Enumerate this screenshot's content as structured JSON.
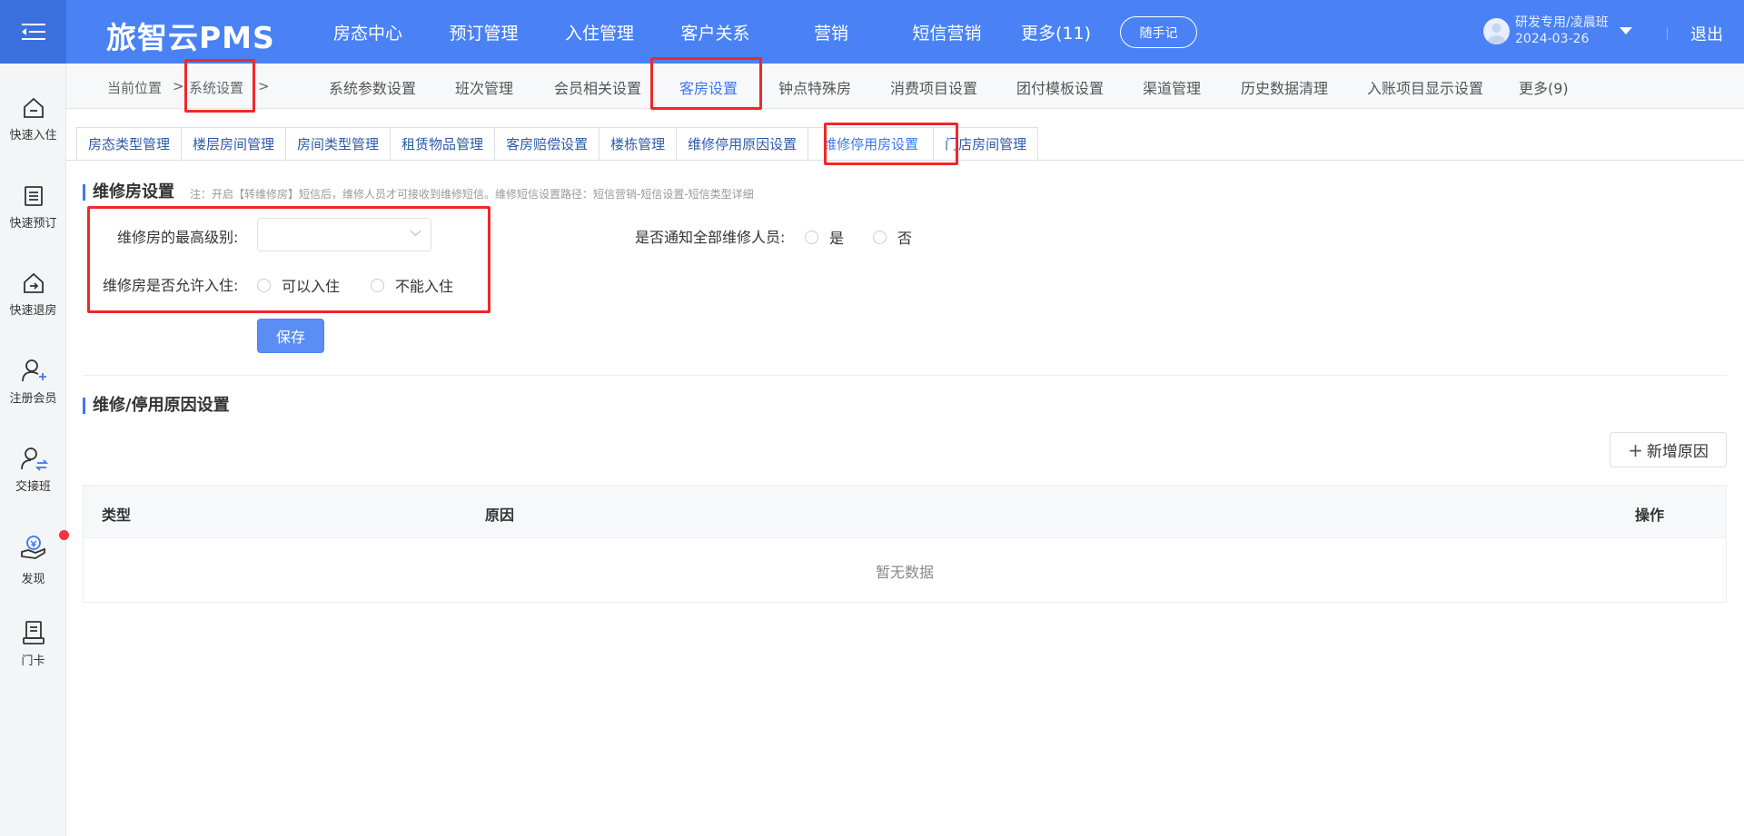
{
  "header": {
    "brand": "旅智云PMS",
    "nav": [
      "房态中心",
      "预订管理",
      "入住管理",
      "客户关系",
      "营销",
      "短信营销",
      "更多(11)"
    ],
    "memo_label": "随手记",
    "user_name": "研发专用/凌晨班",
    "user_date": "2024-03-26",
    "logout_label": "退出"
  },
  "sidebar": {
    "items": [
      {
        "label": "快速入住",
        "icon": "home-in-icon"
      },
      {
        "label": "快速预订",
        "icon": "booking-list-icon"
      },
      {
        "label": "快速退房",
        "icon": "checkout-icon"
      },
      {
        "label": "注册会员",
        "icon": "add-member-icon"
      },
      {
        "label": "交接班",
        "icon": "shift-change-icon"
      },
      {
        "label": "发现",
        "icon": "discover-icon"
      },
      {
        "label": "门卡",
        "icon": "door-card-icon"
      }
    ]
  },
  "breadcrumb": {
    "current_label": "当前位置",
    "sep": ">",
    "item": "系统设置"
  },
  "subnav": {
    "items": [
      "系统参数设置",
      "班次管理",
      "会员相关设置",
      "客房设置",
      "钟点特殊房",
      "消费项目设置",
      "团付模板设置",
      "渠道管理",
      "历史数据清理",
      "入账项目显示设置",
      "更多(9)"
    ],
    "active": "客房设置"
  },
  "tabs": {
    "items": [
      "房态类型管理",
      "楼层房间管理",
      "房间类型管理",
      "租赁物品管理",
      "客房赔偿设置",
      "楼栋管理",
      "维修停用原因设置",
      "维修停用房设置",
      "门店房间管理"
    ],
    "active": "维修停用房设置"
  },
  "repair_settings": {
    "title": "维修房设置",
    "note": "注：开启【转维修房】短信后，维修人员才可接收到维修短信。维修短信设置路径：短信营销-短信设置-短信类型详细",
    "max_level_label": "维修房的最高级别:",
    "max_level_value": "",
    "notify_label": "是否通知全部维修人员:",
    "notify_yes": "是",
    "notify_no": "否",
    "allow_label": "维修房是否允许入住:",
    "allow_yes": "可以入住",
    "allow_no": "不能入住",
    "save_label": "保存"
  },
  "reason_settings": {
    "title": "维修/停用原因设置",
    "add_label": "新增原因",
    "columns": [
      "类型",
      "原因",
      "操作"
    ],
    "empty_text": "暂无数据"
  },
  "colors": {
    "primary": "#4a82f5",
    "highlight": "#f02828"
  }
}
